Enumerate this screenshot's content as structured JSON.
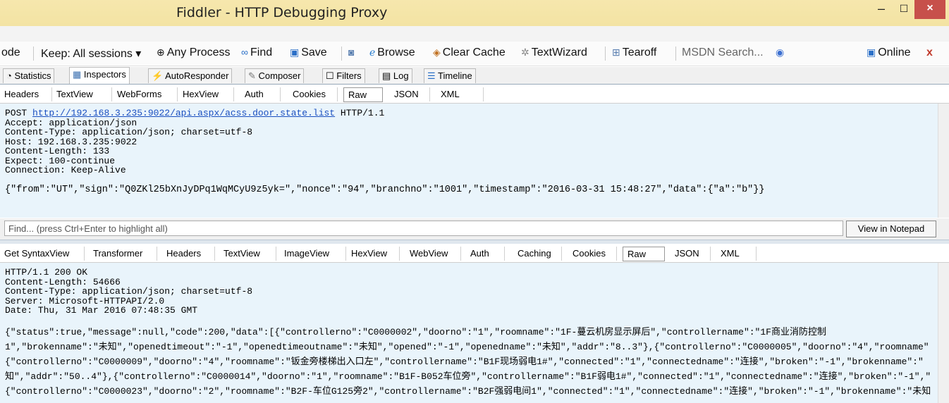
{
  "window": {
    "title": "Fiddler - HTTP Debugging Proxy",
    "min_glyph": "–",
    "max_glyph": "☐",
    "close_glyph": "×"
  },
  "toolbar": {
    "decode_fragment": "ode",
    "keep": "Keep: All sessions ▾",
    "any_process": "Any Process",
    "find": "Find",
    "save": "Save",
    "browse": "Browse",
    "clear_cache": "Clear Cache",
    "text_wizard": "TextWizard",
    "tearoff": "Tearoff",
    "msdn_placeholder": "MSDN Search...",
    "online": "Online",
    "online_close": "x"
  },
  "main_tabs": [
    "Statistics",
    "Inspectors",
    "AutoResponder",
    "Composer",
    "Filters",
    "Log",
    "Timeline"
  ],
  "request": {
    "tabs": [
      "Headers",
      "TextView",
      "WebForms",
      "HexView",
      "Auth",
      "Cookies",
      "Raw",
      "JSON",
      "XML"
    ],
    "active_tab": "Raw",
    "method": "POST",
    "url": "http://192.168.3.235:9022/api.aspx/acss.door.state.list",
    "protocol": "HTTP/1.1",
    "headers": [
      "Accept: application/json",
      "Content-Type: application/json; charset=utf-8",
      "Host: 192.168.3.235:9022",
      "Content-Length: 133",
      "Expect: 100-continue",
      "Connection: Keep-Alive"
    ],
    "body": "{\"from\":\"UT\",\"sign\":\"Q0ZKl25bXnJyDPq1WqMCyU9z5yk=\",\"nonce\":\"94\",\"branchno\":\"1001\",\"timestamp\":\"2016-03-31 15:48:27\",\"data\":{\"a\":\"b\"}}"
  },
  "find_bar": {
    "placeholder": "Find... (press Ctrl+Enter to highlight all)",
    "button": "View in Notepad"
  },
  "response": {
    "tabs": [
      "Get SyntaxView",
      "Transformer",
      "Headers",
      "TextView",
      "ImageView",
      "HexView",
      "WebView",
      "Auth",
      "Caching",
      "Cookies",
      "Raw",
      "JSON",
      "XML"
    ],
    "active_tab": "Raw",
    "headers": [
      "HTTP/1.1 200 OK",
      "Content-Length: 54666",
      "Content-Type: application/json; charset=utf-8",
      "Server: Microsoft-HTTPAPI/2.0",
      "Date: Thu, 31 Mar 2016 07:48:35 GMT"
    ],
    "body_lines": [
      "{\"status\":true,\"message\":null,\"code\":200,\"data\":[{\"controllerno\":\"C0000002\",\"doorno\":\"1\",\"roomname\":\"1F-蔓云机房显示屏后\",\"controllername\":\"1F商业消防控制",
      "1\",\"brokenname\":\"未知\",\"openedtimeout\":\"-1\",\"openedtimeoutname\":\"未知\",\"opened\":\"-1\",\"openedname\":\"未知\",\"addr\":\"8..3\"},{\"controllerno\":\"C0000005\",\"doorno\":\"4\",\"roomname\"",
      "{\"controllerno\":\"C0000009\",\"doorno\":\"4\",\"roomname\":\"钣金旁楼梯出入口左\",\"controllername\":\"B1F现场弱电1#\",\"connected\":\"1\",\"connectedname\":\"连接\",\"broken\":\"-1\",\"brokenname\":\"",
      "知\",\"addr\":\"50..4\"},{\"controllerno\":\"C0000014\",\"doorno\":\"1\",\"roomname\":\"B1F-B052车位旁\",\"controllername\":\"B1F弱电1#\",\"connected\":\"1\",\"connectedname\":\"连接\",\"broken\":\"-1\",\"",
      "{\"controllerno\":\"C0000023\",\"doorno\":\"2\",\"roomname\":\"B2F-车位G125旁2\",\"controllername\":\"B2F强弱电间1\",\"connected\":\"1\",\"connectedname\":\"连接\",\"broken\":\"-1\",\"brokenname\":\"未知"
    ]
  }
}
